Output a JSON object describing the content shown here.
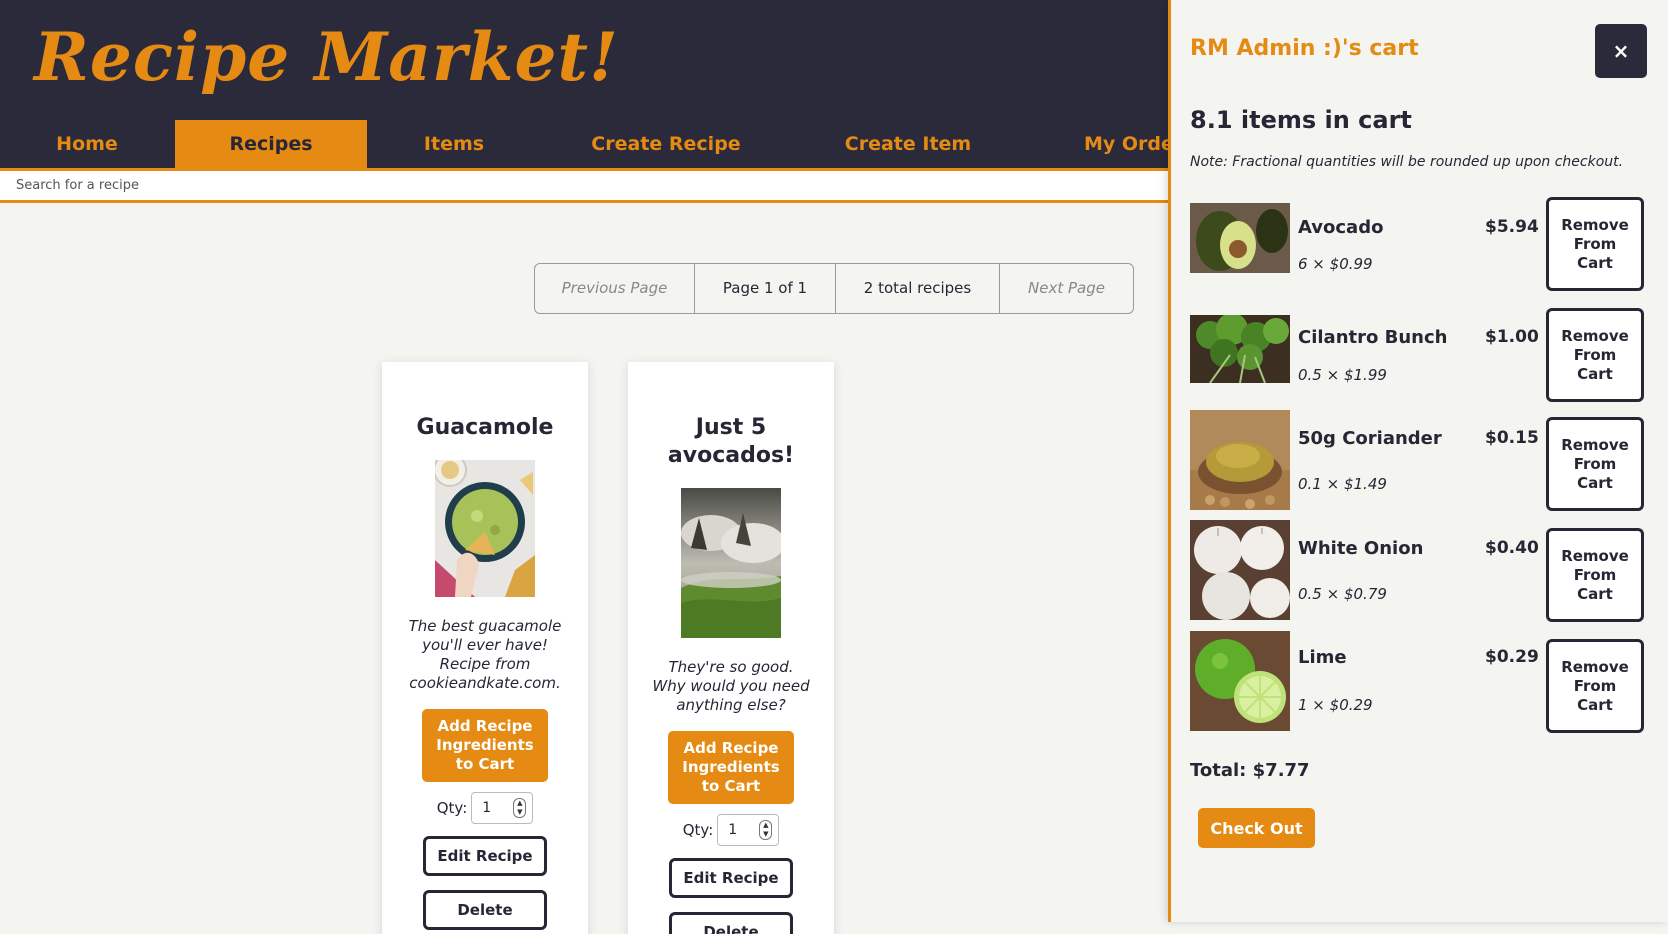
{
  "header": {
    "logo": "Recipe Market!",
    "nav": [
      {
        "label": "Home"
      },
      {
        "label": "Recipes"
      },
      {
        "label": "Items"
      },
      {
        "label": "Create Recipe"
      },
      {
        "label": "Create Item"
      },
      {
        "label": "My Orders"
      }
    ],
    "active_nav": "Recipes",
    "search_placeholder": "Search for a recipe"
  },
  "pagination": {
    "previous": "Previous Page",
    "page": "Page 1 of 1",
    "total": "2 total recipes",
    "next": "Next Page"
  },
  "recipes": [
    {
      "title": "Guacamole",
      "image_icon": "guacamole-bowl-photo",
      "description": "The best guacamole you'll ever have! Recipe from cookieandkate.com.",
      "add_label": "Add Recipe Ingredients to Cart",
      "qty_label": "Qty:",
      "qty_value": "1",
      "edit_label": "Edit Recipe",
      "delete_label": "Delete"
    },
    {
      "title": "Just 5 avocados!",
      "image_icon": "misty-landscape-photo",
      "description": "They're so good. Why would you need anything else?",
      "add_label": "Add Recipe Ingredients to Cart",
      "qty_label": "Qty:",
      "qty_value": "1",
      "edit_label": "Edit Recipe",
      "delete_label": "Delete"
    }
  ],
  "cart": {
    "title": "RM Admin :)'s cart",
    "close_label": "×",
    "count": "8.1 items in cart",
    "note": "Note: Fractional quantities will be rounded up upon checkout.",
    "items": [
      {
        "name": "Avocado",
        "qty": "6 × $0.99",
        "price": "$5.94",
        "remove": "Remove From Cart",
        "icon": "avocado-photo"
      },
      {
        "name": "Cilantro Bunch",
        "qty": "0.5 × $1.99",
        "price": "$1.00",
        "remove": "Remove From Cart",
        "icon": "cilantro-photo"
      },
      {
        "name": "50g Coriander",
        "qty": "0.1 × $1.49",
        "price": "$0.15",
        "remove": "Remove From Cart",
        "icon": "coriander-photo"
      },
      {
        "name": "White Onion",
        "qty": "0.5 × $0.79",
        "price": "$0.40",
        "remove": "Remove From Cart",
        "icon": "white-onion-photo"
      },
      {
        "name": "Lime",
        "qty": "1 × $0.29",
        "price": "$0.29",
        "remove": "Remove From Cart",
        "icon": "lime-photo"
      }
    ],
    "total": "Total: $7.77",
    "checkout": "Check Out"
  },
  "colors": {
    "accent": "#e58a12",
    "header_bg": "#2b2a3b",
    "page_bg": "#f4f5f1",
    "text": "#262635"
  }
}
